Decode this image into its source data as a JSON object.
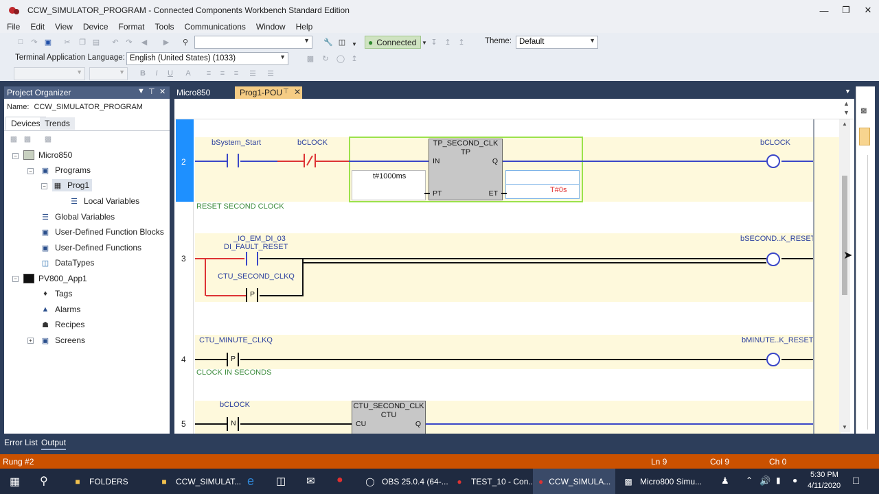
{
  "window": {
    "title": "CCW_SIMULATOR_PROGRAM - Connected Components Workbench Standard Edition"
  },
  "menu": [
    "File",
    "Edit",
    "View",
    "Device",
    "Format",
    "Tools",
    "Communications",
    "Window",
    "Help"
  ],
  "toolbar": {
    "connection_status": "Connected",
    "theme_label": "Theme:",
    "theme_value": "Default",
    "terminal_lang_label": "Terminal Application Language:",
    "terminal_lang_value": "English (United States) (1033)"
  },
  "organizer": {
    "title": "Project Organizer",
    "name_label": "Name:",
    "name_value": "CCW_SIMULATOR_PROGRAM",
    "tabs": [
      "Devices",
      "Trends"
    ],
    "tree": [
      {
        "label": "Micro850",
        "icon": "plc-icon"
      },
      {
        "label": "Programs",
        "icon": "programs-icon"
      },
      {
        "label": "Prog1",
        "icon": "program-icon"
      },
      {
        "label": "Local Variables",
        "icon": "variables-icon"
      },
      {
        "label": "Global Variables",
        "icon": "variables-icon"
      },
      {
        "label": "User-Defined Function Blocks",
        "icon": "function-block-icon"
      },
      {
        "label": "User-Defined Functions",
        "icon": "function-icon"
      },
      {
        "label": "DataTypes",
        "icon": "datatypes-icon"
      },
      {
        "label": "PV800_App1",
        "icon": "hmi-icon"
      },
      {
        "label": "Tags",
        "icon": "tag-icon"
      },
      {
        "label": "Alarms",
        "icon": "alarm-icon"
      },
      {
        "label": "Recipes",
        "icon": "recipe-icon"
      },
      {
        "label": "Screens",
        "icon": "screens-icon"
      }
    ]
  },
  "editor": {
    "tabs": [
      "Micro850",
      "Prog1-POU"
    ],
    "rungs": {
      "r2": {
        "number": "2",
        "contact1": "bSystem_Start",
        "contact2": "bCLOCK",
        "fb_instance": "TP_SECOND_CLK",
        "fb_type": "TP",
        "pin_in": "IN",
        "pin_q": "Q",
        "pin_pt": "PT",
        "pin_et": "ET",
        "pt_value": "t#1000ms",
        "et_value": "T#0s",
        "coil": "bCLOCK",
        "comment_after": "RESET SECOND CLOCK"
      },
      "r3": {
        "number": "3",
        "contact1_line1": "_IO_EM_DI_03",
        "contact1_line2": "DI_FAULT_RESET",
        "contact2": "CTU_SECOND_CLKQ",
        "contact2_type": "P",
        "coil": "bSECOND..K_RESET"
      },
      "r4": {
        "number": "4",
        "contact1": "CTU_MINUTE_CLKQ",
        "contact1_type": "P",
        "coil": "bMINUTE..K_RESET",
        "comment_after": "CLOCK IN SECONDS"
      },
      "r5": {
        "number": "5",
        "contact1": "bCLOCK",
        "contact1_type": "N",
        "fb_instance": "CTU_SECOND_CLK",
        "fb_type": "CTU",
        "pin_cu": "CU",
        "pin_q": "Q"
      }
    }
  },
  "bottom": {
    "tabs": [
      "Error List",
      "Output"
    ],
    "status_left": "Rung #2",
    "ln": "Ln 9",
    "col": "Col 9",
    "ch": "Ch 0"
  },
  "taskbar": {
    "items": [
      "FOLDERS",
      "CCW_SIMULAT...",
      "OBS 25.0.4 (64-...",
      "TEST_10 - Con...",
      "CCW_SIMULA...",
      "Micro800 Simu..."
    ],
    "time": "5:30 PM",
    "date": "4/11/2020"
  },
  "colors": {
    "accent": "#2d3e5b",
    "status_bar": "#ca5100",
    "rung_background": "#fef9dc",
    "wire_energized": "#3a46c8",
    "connected_bg": "#cfe3c1"
  }
}
